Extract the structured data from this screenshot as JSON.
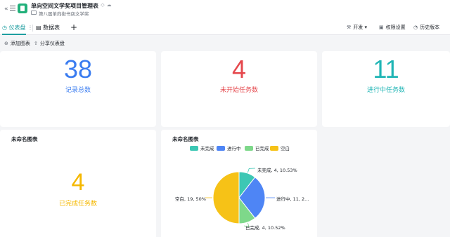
{
  "header": {
    "title": "单向空间文学奖项目管理表",
    "breadcrumb": "第八届单向街书店文学奖"
  },
  "tabs": [
    {
      "label": "仪表盘",
      "icon": "dashboard-icon",
      "active": true
    },
    {
      "label": "数据表",
      "icon": "table-icon",
      "active": false
    }
  ],
  "header_actions": {
    "dev_label": "开发",
    "perm_label": "权限设置",
    "history_label": "历史版本"
  },
  "toolbar": {
    "add_chart_label": "添加图表",
    "share_label": "分享仪表盘"
  },
  "stats": [
    {
      "value": "38",
      "label": "记录总数",
      "color": "#3a7cf0"
    },
    {
      "value": "4",
      "label": "未开始任务数",
      "color": "#e5484d"
    },
    {
      "value": "11",
      "label": "进行中任务数",
      "color": "#1fb5b5"
    },
    {
      "value": "4",
      "label": "已完成任务数",
      "color": "#f5b800"
    }
  ],
  "widgets": {
    "stat_card_title": "未命名图表",
    "pie_card_title": "未命名图表"
  },
  "chart_data": {
    "type": "pie",
    "title": "未命名图表",
    "legend_position": "top",
    "series": [
      {
        "name": "未完成",
        "value": 4,
        "percent": "10.53%",
        "color": "#3cc7b4",
        "label": "未完成, 4, 10.53%"
      },
      {
        "name": "进行中",
        "value": 11,
        "percent": "28.95%",
        "color": "#4e85f5",
        "label": "进行中, 11, 2..."
      },
      {
        "name": "已完成",
        "value": 4,
        "percent": "10.52%",
        "color": "#7ed88a",
        "label": "已完成, 4, 10.52%"
      },
      {
        "name": "空白",
        "value": 19,
        "percent": "50%",
        "color": "#f6c217",
        "label": "空白, 19, 50%"
      }
    ]
  }
}
